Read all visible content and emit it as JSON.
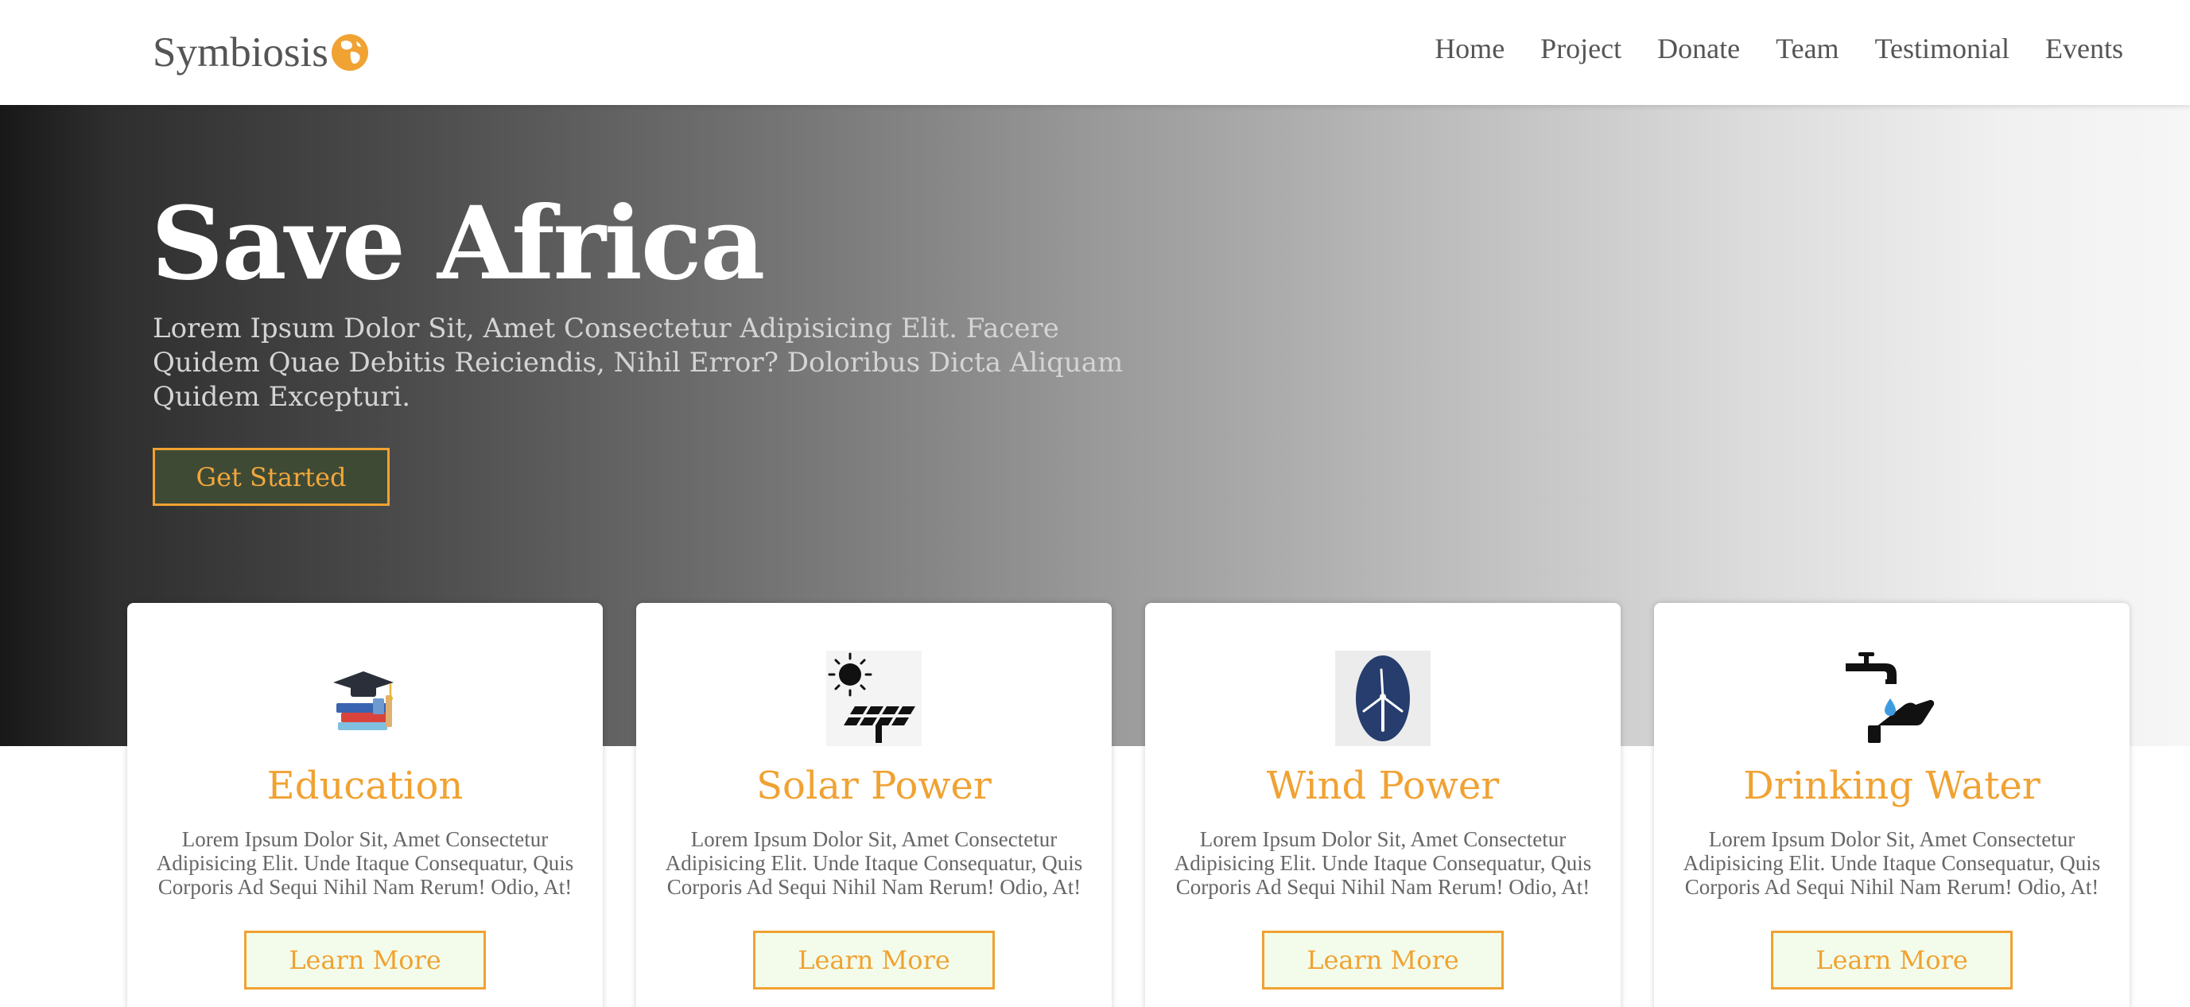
{
  "nav": {
    "logo_text": "Symbiosis",
    "logo_icon": "globe-icon",
    "links": [
      "Home",
      "Project",
      "Donate",
      "Team",
      "Testimonial",
      "Events"
    ]
  },
  "hero": {
    "title": "Save Africa",
    "subtitle": "Lorem Ipsum Dolor Sit, Amet Consectetur Adipisicing Elit. Facere Quidem Quae Debitis Reiciendis, Nihil Error? Doloribus Dicta Aliquam Quidem Excepturi.",
    "button_label": "Get Started"
  },
  "cards": [
    {
      "icon": "graduation-books-icon",
      "title": "Education",
      "text": "Lorem Ipsum Dolor Sit, Amet Consectetur Adipisicing Elit. Unde Itaque Consequatur, Quis Corporis Ad Sequi Nihil Nam Rerum! Odio, At!",
      "button": "Learn More"
    },
    {
      "icon": "solar-panel-icon",
      "title": "Solar Power",
      "text": "Lorem Ipsum Dolor Sit, Amet Consectetur Adipisicing Elit. Unde Itaque Consequatur, Quis Corporis Ad Sequi Nihil Nam Rerum! Odio, At!",
      "button": "Learn More"
    },
    {
      "icon": "wind-turbine-icon",
      "title": "Wind Power",
      "text": "Lorem Ipsum Dolor Sit, Amet Consectetur Adipisicing Elit. Unde Itaque Consequatur, Quis Corporis Ad Sequi Nihil Nam Rerum! Odio, At!",
      "button": "Learn More"
    },
    {
      "icon": "water-tap-icon",
      "title": "Drinking Water",
      "text": "Lorem Ipsum Dolor Sit, Amet Consectetur Adipisicing Elit. Unde Itaque Consequatur, Quis Corporis Ad Sequi Nihil Nam Rerum! Odio, At!",
      "button": "Learn More"
    }
  ],
  "colors": {
    "accent": "#f0a232",
    "card_button_bg": "#f3fcea",
    "hero_button_bg": "#3f4a35"
  }
}
